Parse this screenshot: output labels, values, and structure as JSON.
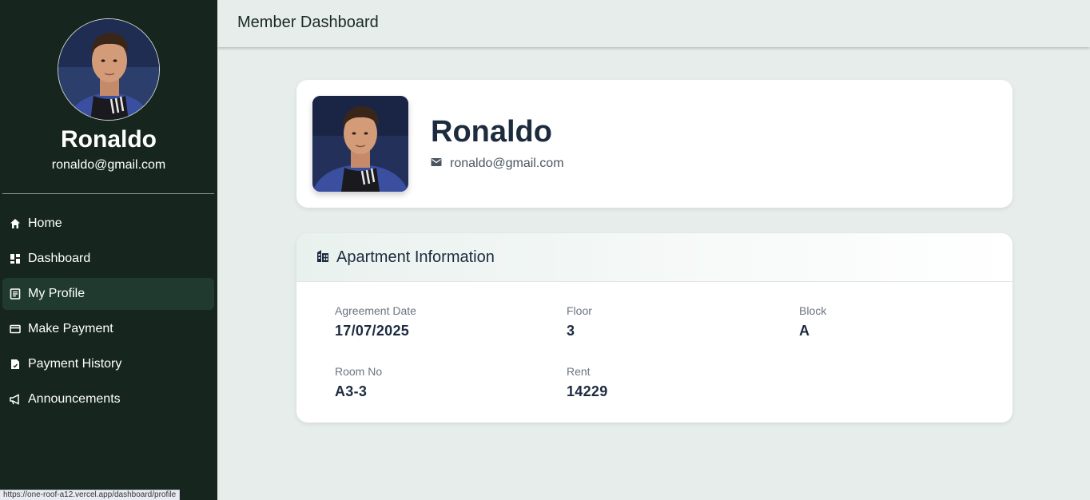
{
  "sidebar": {
    "user_name": "Ronaldo",
    "user_email": "ronaldo@gmail.com",
    "items": [
      {
        "label": "Home",
        "icon": "home-icon",
        "active": false
      },
      {
        "label": "Dashboard",
        "icon": "dashboard-icon",
        "active": false
      },
      {
        "label": "My Profile",
        "icon": "profile-icon",
        "active": true
      },
      {
        "label": "Make Payment",
        "icon": "credit-card-icon",
        "active": false
      },
      {
        "label": "Payment History",
        "icon": "receipt-icon",
        "active": false
      },
      {
        "label": "Announcements",
        "icon": "megaphone-icon",
        "active": false
      }
    ]
  },
  "header": {
    "title": "Member Dashboard"
  },
  "profile": {
    "name": "Ronaldo",
    "email": "ronaldo@gmail.com",
    "email_icon": "mail-icon"
  },
  "apartment": {
    "title": "Apartment Information",
    "title_icon": "building-icon",
    "fields": [
      {
        "label": "Agreement Date",
        "value": "17/07/2025"
      },
      {
        "label": "Floor",
        "value": "3"
      },
      {
        "label": "Block",
        "value": "A"
      },
      {
        "label": "Room No",
        "value": "A3-3"
      },
      {
        "label": "Rent",
        "value": "14229"
      }
    ]
  },
  "status_bar": {
    "url": "https://one-roof-a12.vercel.app/dashboard/profile"
  },
  "colors": {
    "sidebar_bg": "#16261f",
    "active_item_bg": "#203a2f",
    "page_bg": "#e6edea",
    "text_dark": "#1d2b3f"
  }
}
